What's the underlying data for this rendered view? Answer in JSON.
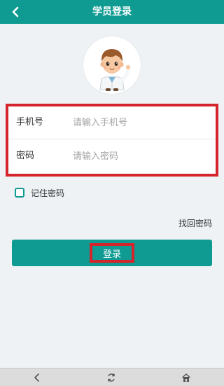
{
  "header": {
    "title": "学员登录",
    "back_icon": "chevron-left-icon"
  },
  "avatar": {
    "icon": "doctor-cartoon-avatar"
  },
  "form": {
    "phone_label": "手机号",
    "phone_placeholder": "请输入手机号",
    "phone_value": "",
    "password_label": "密码",
    "password_placeholder": "请输入密码",
    "password_value": ""
  },
  "remember": {
    "label": "记住密码",
    "checked": false
  },
  "forgot_label": "找回密码",
  "login_label": "登录",
  "nav": {
    "back_icon": "nav-back-icon",
    "refresh_icon": "refresh-icon",
    "home_icon": "home-icon"
  },
  "colors": {
    "primary": "#0f9b92",
    "highlight": "#d6242d",
    "background": "#eef2f5"
  }
}
